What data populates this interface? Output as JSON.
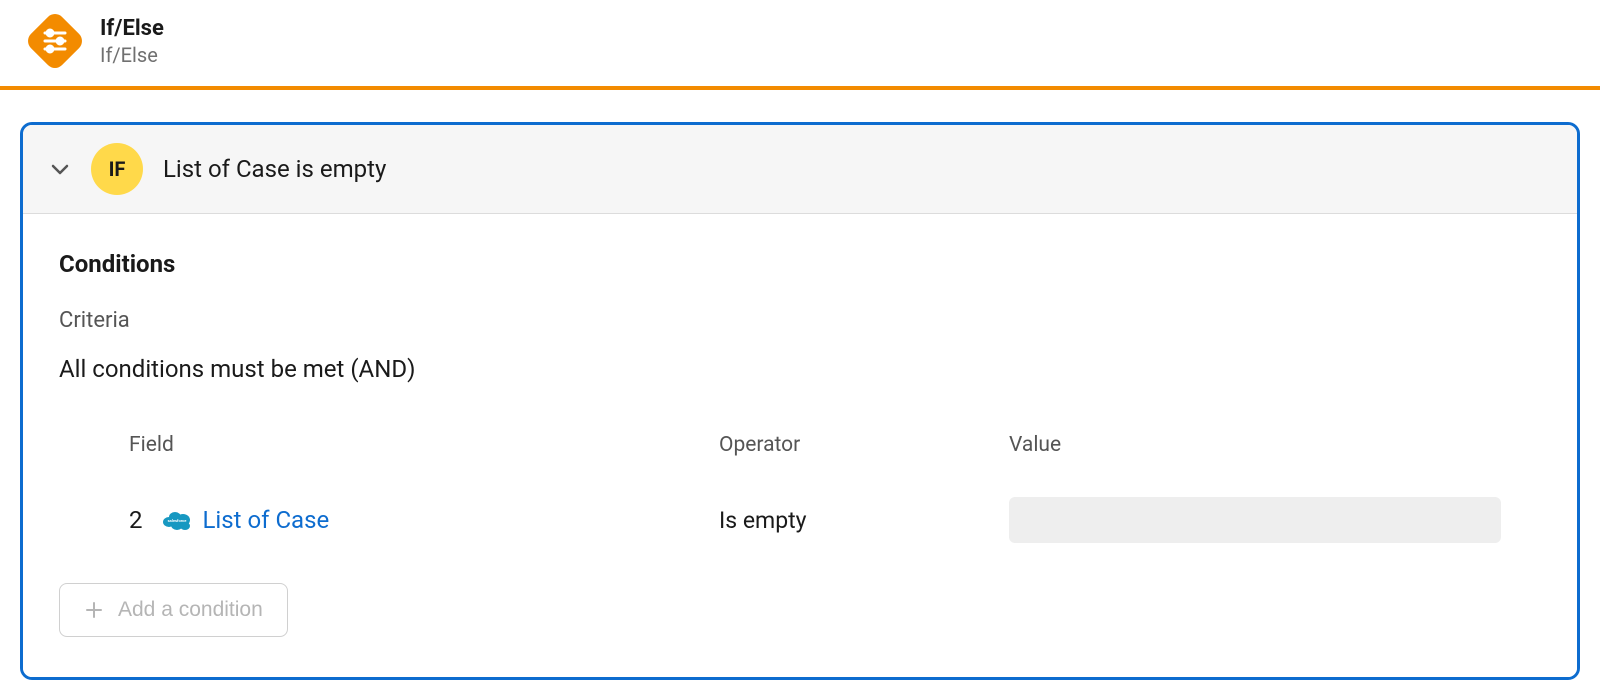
{
  "header": {
    "title": "If/Else",
    "subtitle": "If/Else"
  },
  "panel": {
    "badge": "IF",
    "header_text": "List of Case is empty"
  },
  "conditions": {
    "heading": "Conditions",
    "criteria_label": "Criteria",
    "criteria_value": "All conditions must be met (AND)"
  },
  "columns": {
    "field": "Field",
    "operator": "Operator",
    "value": "Value"
  },
  "row": {
    "number": "2",
    "field_label": "List of Case",
    "operator": "Is empty"
  },
  "add_button": {
    "label": "Add a condition"
  }
}
